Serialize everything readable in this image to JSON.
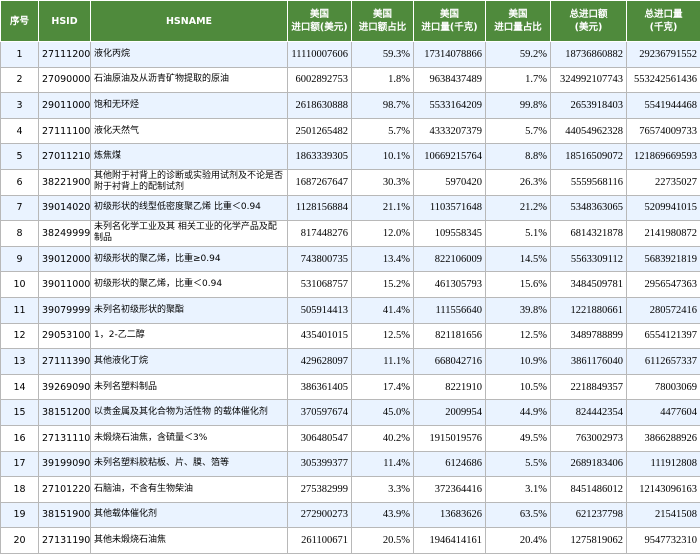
{
  "header": {
    "rank": "序号",
    "hsid": "HSID",
    "hsname": "HSNAME",
    "us_import_value": "美国\n进口额(美元)",
    "us_import_value_share": "美国\n进口额占比",
    "us_import_qty": "美国\n进口量(千克)",
    "us_import_qty_share": "美国\n进口量占比",
    "total_import_value": "总进口额\n(美元)",
    "total_import_qty": "总进口量\n(千克)"
  },
  "rows": [
    {
      "rank": "1",
      "hsid": "27111200",
      "name": "液化丙烷",
      "us_value": "11110007606",
      "us_value_share": "59.3%",
      "us_qty": "17314078866",
      "us_qty_share": "59.2%",
      "total_value": "18736860882",
      "total_qty": "29236791552"
    },
    {
      "rank": "2",
      "hsid": "27090000",
      "name": "石油原油及从沥青矿物提取的原油",
      "us_value": "6002892753",
      "us_value_share": "1.8%",
      "us_qty": "9638437489",
      "us_qty_share": "1.7%",
      "total_value": "324992107743",
      "total_qty": "553242561436"
    },
    {
      "rank": "3",
      "hsid": "29011000",
      "name": "饱和无环烃",
      "us_value": "2618630888",
      "us_value_share": "98.7%",
      "us_qty": "5533164209",
      "us_qty_share": "99.8%",
      "total_value": "2653918403",
      "total_qty": "5541944468"
    },
    {
      "rank": "4",
      "hsid": "27111100",
      "name": "液化天然气",
      "us_value": "2501265482",
      "us_value_share": "5.7%",
      "us_qty": "4333207379",
      "us_qty_share": "5.7%",
      "total_value": "44054962328",
      "total_qty": "76574009733"
    },
    {
      "rank": "5",
      "hsid": "27011210",
      "name": "炼焦煤",
      "us_value": "1863339305",
      "us_value_share": "10.1%",
      "us_qty": "10669215764",
      "us_qty_share": "8.8%",
      "total_value": "18516509072",
      "total_qty": "121869669593"
    },
    {
      "rank": "6",
      "hsid": "38221900",
      "name": "其他附于衬背上的诊断或实验用试剂及不论是否附于衬背上的配制试剂",
      "us_value": "1687267647",
      "us_value_share": "30.3%",
      "us_qty": "5970420",
      "us_qty_share": "26.3%",
      "total_value": "5559568116",
      "total_qty": "22735027"
    },
    {
      "rank": "7",
      "hsid": "39014020",
      "name": "初级形状的线型低密度聚乙烯 比重＜0.94",
      "us_value": "1128156884",
      "us_value_share": "21.1%",
      "us_qty": "1103571648",
      "us_qty_share": "21.2%",
      "total_value": "5348363065",
      "total_qty": "5209941015"
    },
    {
      "rank": "8",
      "hsid": "38249999",
      "name": "未列名化学工业及其 相关工业的化学产品及配制品",
      "us_value": "817448276",
      "us_value_share": "12.0%",
      "us_qty": "109558345",
      "us_qty_share": "5.1%",
      "total_value": "6814321878",
      "total_qty": "2141980872"
    },
    {
      "rank": "9",
      "hsid": "39012000",
      "name": "初级形状的聚乙烯，比重≥0.94",
      "us_value": "743800735",
      "us_value_share": "13.4%",
      "us_qty": "822106009",
      "us_qty_share": "14.5%",
      "total_value": "5563309112",
      "total_qty": "5683921819"
    },
    {
      "rank": "10",
      "hsid": "39011000",
      "name": "初级形状的聚乙烯，比重＜0.94",
      "us_value": "531068757",
      "us_value_share": "15.2%",
      "us_qty": "461305793",
      "us_qty_share": "15.6%",
      "total_value": "3484509781",
      "total_qty": "2956547363"
    },
    {
      "rank": "11",
      "hsid": "39079999",
      "name": "未列名初级形状的聚酯",
      "us_value": "505914413",
      "us_value_share": "41.4%",
      "us_qty": "111556640",
      "us_qty_share": "39.8%",
      "total_value": "1221880661",
      "total_qty": "280572416"
    },
    {
      "rank": "12",
      "hsid": "29053100",
      "name": "1，2-乙二醇",
      "us_value": "435401015",
      "us_value_share": "12.5%",
      "us_qty": "821181656",
      "us_qty_share": "12.5%",
      "total_value": "3489788899",
      "total_qty": "6554121397"
    },
    {
      "rank": "13",
      "hsid": "27111390",
      "name": "其他液化丁烷",
      "us_value": "429628097",
      "us_value_share": "11.1%",
      "us_qty": "668042716",
      "us_qty_share": "10.9%",
      "total_value": "3861176040",
      "total_qty": "6112657337"
    },
    {
      "rank": "14",
      "hsid": "39269090",
      "name": "未列名塑料制品",
      "us_value": "386361405",
      "us_value_share": "17.4%",
      "us_qty": "8221910",
      "us_qty_share": "10.5%",
      "total_value": "2218849357",
      "total_qty": "78003069"
    },
    {
      "rank": "15",
      "hsid": "38151200",
      "name": "以贵金属及其化合物为活性物 的载体催化剂",
      "us_value": "370597674",
      "us_value_share": "45.0%",
      "us_qty": "2009954",
      "us_qty_share": "44.9%",
      "total_value": "824442354",
      "total_qty": "4477604"
    },
    {
      "rank": "16",
      "hsid": "27131110",
      "name": "未煅烧石油焦，含硫量＜3%",
      "us_value": "306480547",
      "us_value_share": "40.2%",
      "us_qty": "1915019576",
      "us_qty_share": "49.5%",
      "total_value": "763002973",
      "total_qty": "3866288926"
    },
    {
      "rank": "17",
      "hsid": "39199090",
      "name": "未列名塑料胶粘板、片、膜、箔等",
      "us_value": "305399377",
      "us_value_share": "11.4%",
      "us_qty": "6124686",
      "us_qty_share": "5.5%",
      "total_value": "2689183406",
      "total_qty": "111912808"
    },
    {
      "rank": "18",
      "hsid": "27101220",
      "name": "石脑油，不含有生物柴油",
      "us_value": "275382999",
      "us_value_share": "3.3%",
      "us_qty": "372364416",
      "us_qty_share": "3.1%",
      "total_value": "8451486012",
      "total_qty": "12143096163"
    },
    {
      "rank": "19",
      "hsid": "38151900",
      "name": "其他载体催化剂",
      "us_value": "272900273",
      "us_value_share": "43.9%",
      "us_qty": "13683626",
      "us_qty_share": "63.5%",
      "total_value": "621237798",
      "total_qty": "21541508"
    },
    {
      "rank": "20",
      "hsid": "27131190",
      "name": "其他未煅烧石油焦",
      "us_value": "261100671",
      "us_value_share": "20.5%",
      "us_qty": "1946414161",
      "us_qty_share": "20.4%",
      "total_value": "1275819062",
      "total_qty": "9547732310"
    }
  ]
}
